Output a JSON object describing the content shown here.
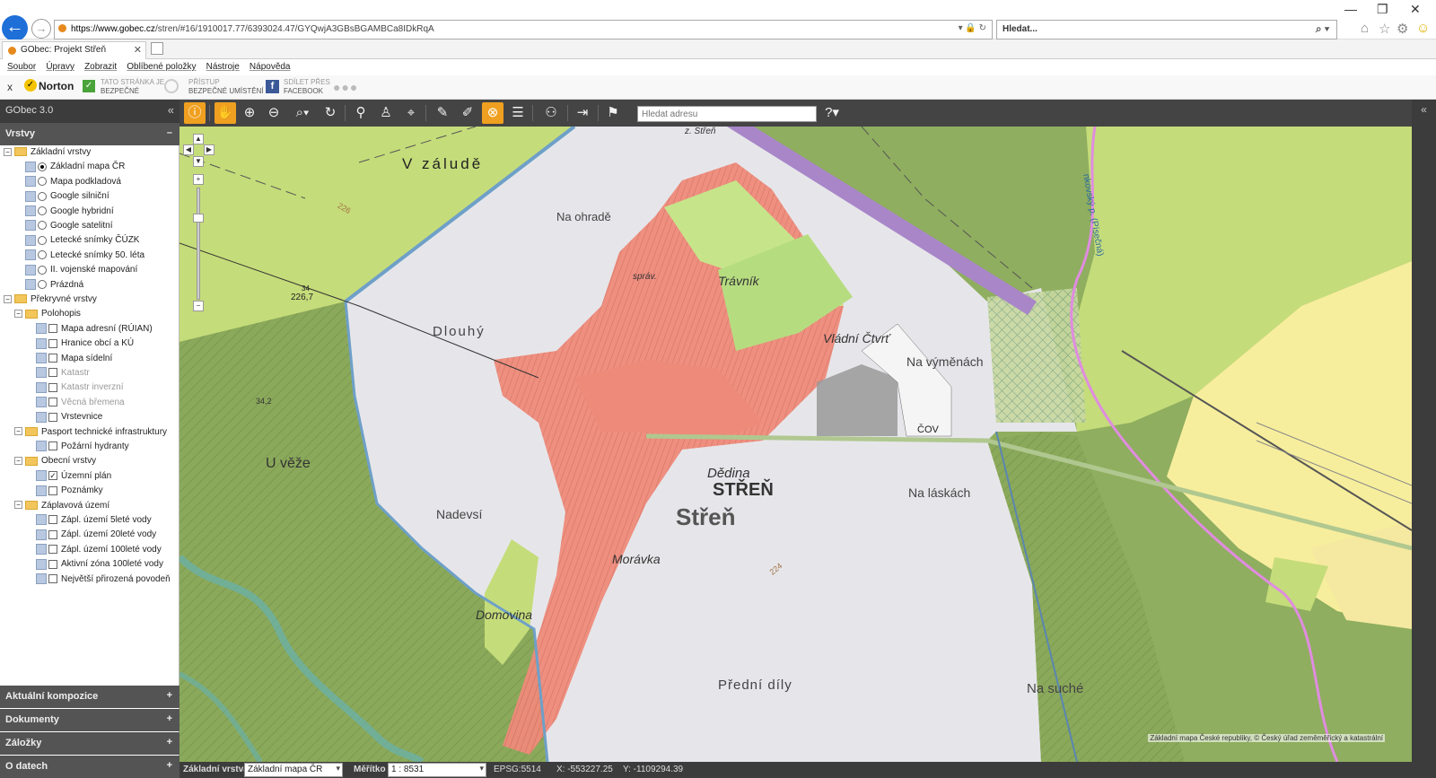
{
  "browser": {
    "url_host": "https://www.gobec.cz",
    "url_path": "/stren/#16/1910017.77/6393024.47/GYQwjA3GBsBGAMBCa8IDkRqA",
    "search_placeholder": "Hledat...",
    "tab_title": "GObec: Projekt Střeň",
    "menu": [
      "Soubor",
      "Úpravy",
      "Zobrazit",
      "Oblíbené položky",
      "Nástroje",
      "Nápověda"
    ],
    "norton_close": "x",
    "norton_label": "Norton",
    "norton_safe_1": "TATO STRÁNKA JE",
    "norton_safe_2": "BEZPEČNÉ",
    "norton_access_1": "PŘÍSTUP",
    "norton_access_2": "BEZPEČNÉ UMÍSTĚNÍ",
    "norton_fb_1": "SDÍLET PŘES",
    "norton_fb_2": "FACEBOOK"
  },
  "app": {
    "title": "GObec 3.0",
    "address_placeholder": "Hledat adresu"
  },
  "sidebar": {
    "layers_title": "Vrstvy",
    "sections": [
      "Aktuální kompozice",
      "Dokumenty",
      "Záložky",
      "O datech"
    ],
    "tree": [
      {
        "type": "group",
        "label": "Základní vrstvy",
        "level": 0
      },
      {
        "type": "radio",
        "label": "Základní mapa ČR",
        "checked": true,
        "level": 2
      },
      {
        "type": "radio",
        "label": "Mapa podkladová",
        "checked": false,
        "level": 2
      },
      {
        "type": "radio",
        "label": "Google silniční",
        "checked": false,
        "level": 2
      },
      {
        "type": "radio",
        "label": "Google hybridní",
        "checked": false,
        "level": 2
      },
      {
        "type": "radio",
        "label": "Google satelitní",
        "checked": false,
        "level": 2
      },
      {
        "type": "radio",
        "label": "Letecké snímky ČÚZK",
        "checked": false,
        "level": 2
      },
      {
        "type": "radio",
        "label": "Letecké snímky 50. léta",
        "checked": false,
        "level": 2
      },
      {
        "type": "radio",
        "label": "II. vojenské mapování",
        "checked": false,
        "level": 2
      },
      {
        "type": "radio",
        "label": "Prázdná",
        "checked": false,
        "level": 2
      },
      {
        "type": "group",
        "label": "Překryvné vrstvy",
        "level": 0
      },
      {
        "type": "group",
        "label": "Polohopis",
        "level": 1
      },
      {
        "type": "check",
        "label": "Mapa adresní (RÚIAN)",
        "checked": false,
        "level": 3
      },
      {
        "type": "check",
        "label": "Hranice obcí a KÚ",
        "checked": false,
        "level": 3
      },
      {
        "type": "check",
        "label": "Mapa sídelní",
        "checked": false,
        "level": 3
      },
      {
        "type": "check",
        "label": "Katastr",
        "checked": false,
        "level": 3,
        "disabled": true
      },
      {
        "type": "check",
        "label": "Katastr inverzní",
        "checked": false,
        "level": 3,
        "disabled": true
      },
      {
        "type": "check",
        "label": "Věcná břemena",
        "checked": false,
        "level": 3,
        "disabled": true
      },
      {
        "type": "check",
        "label": "Vrstevnice",
        "checked": false,
        "level": 3
      },
      {
        "type": "group",
        "label": "Pasport technické infrastruktury",
        "level": 1
      },
      {
        "type": "check",
        "label": "Požární hydranty",
        "checked": false,
        "level": 3
      },
      {
        "type": "group",
        "label": "Obecní vrstvy",
        "level": 1
      },
      {
        "type": "check",
        "label": "Územní plán",
        "checked": true,
        "level": 3
      },
      {
        "type": "check",
        "label": "Poznámky",
        "checked": false,
        "level": 3
      },
      {
        "type": "group",
        "label": "Záplavová území",
        "level": 1
      },
      {
        "type": "check",
        "label": "Zápl. území 5leté vody",
        "checked": false,
        "level": 3
      },
      {
        "type": "check",
        "label": "Zápl. území 20leté vody",
        "checked": false,
        "level": 3
      },
      {
        "type": "check",
        "label": "Zápl. území 100leté vody",
        "checked": false,
        "level": 3
      },
      {
        "type": "check",
        "label": "Aktivní zóna 100leté vody",
        "checked": false,
        "level": 3
      },
      {
        "type": "check",
        "label": "Největší přirozená povodeň",
        "checked": false,
        "level": 3
      }
    ]
  },
  "map": {
    "labels": {
      "v_zalude": "V záludě",
      "na_ohrade": "Na ohradě",
      "dlouhy": "Dlouhý",
      "travnik": "Trávník",
      "vladni_ctvrt": "Vládní Čtvrť",
      "na_vymenach": "Na výměnách",
      "u_veze": "U věže",
      "nadevsi": "Nadevsí",
      "dedina": "Dědina",
      "stren_caps": "STŘEŇ",
      "stren": "Střeň",
      "na_laskach": "Na láskách",
      "moravka": "Morávka",
      "domovina": "Domovina",
      "predni_dily": "Přední díly",
      "na_suche": "Na suché",
      "cov": "ČOV",
      "z_stren": "z. Střeň",
      "spravni": "správ.",
      "elev_1": "226,7",
      "elev_1_top": "34",
      "elev_2": "34,2",
      "contour_226": "226",
      "contour_224": "224",
      "creek": "nkovský p. (Písečná)"
    },
    "attribution": "Základní mapa České republiky, © Český úřad zeměměřický a katastrální"
  },
  "statusbar": {
    "base_layer_label": "Základní vrstva",
    "base_layer_value": "Základní mapa ČR",
    "scale_label": "Měřítko",
    "scale_value": "1 : 8531",
    "epsg": "EPSG:5514",
    "x_coord": "X: -553227.25",
    "y_coord": "Y: -1109294.39"
  }
}
